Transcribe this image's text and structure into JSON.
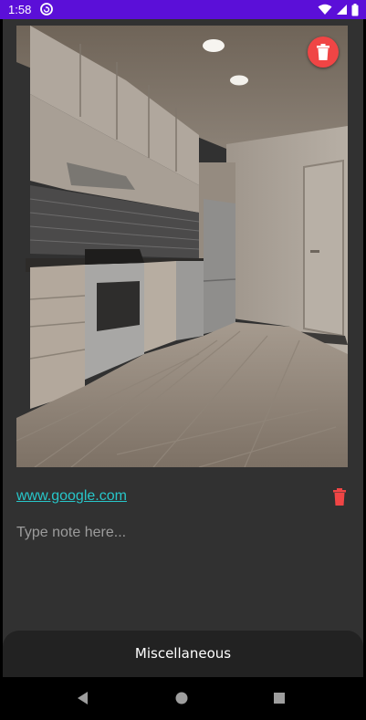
{
  "status_bar": {
    "time": "1:58",
    "app_icon": "sync-circle-icon",
    "wifi_icon": "wifi-icon",
    "signal_icon": "cell-signal-icon",
    "battery_icon": "battery-icon",
    "background_color": "#5b0fd8"
  },
  "photo": {
    "description_icon": "kitchen-photo",
    "delete_icon": "trash-icon",
    "delete_color": "#f04545"
  },
  "link": {
    "text": "www.google.com",
    "color": "#27c6c9",
    "delete_icon": "trash-icon"
  },
  "note": {
    "placeholder": "Type note here..."
  },
  "bottom_sheet": {
    "title": "Miscellaneous"
  },
  "nav": {
    "back_icon": "back-triangle-icon",
    "home_icon": "home-circle-icon",
    "recents_icon": "recents-square-icon"
  }
}
